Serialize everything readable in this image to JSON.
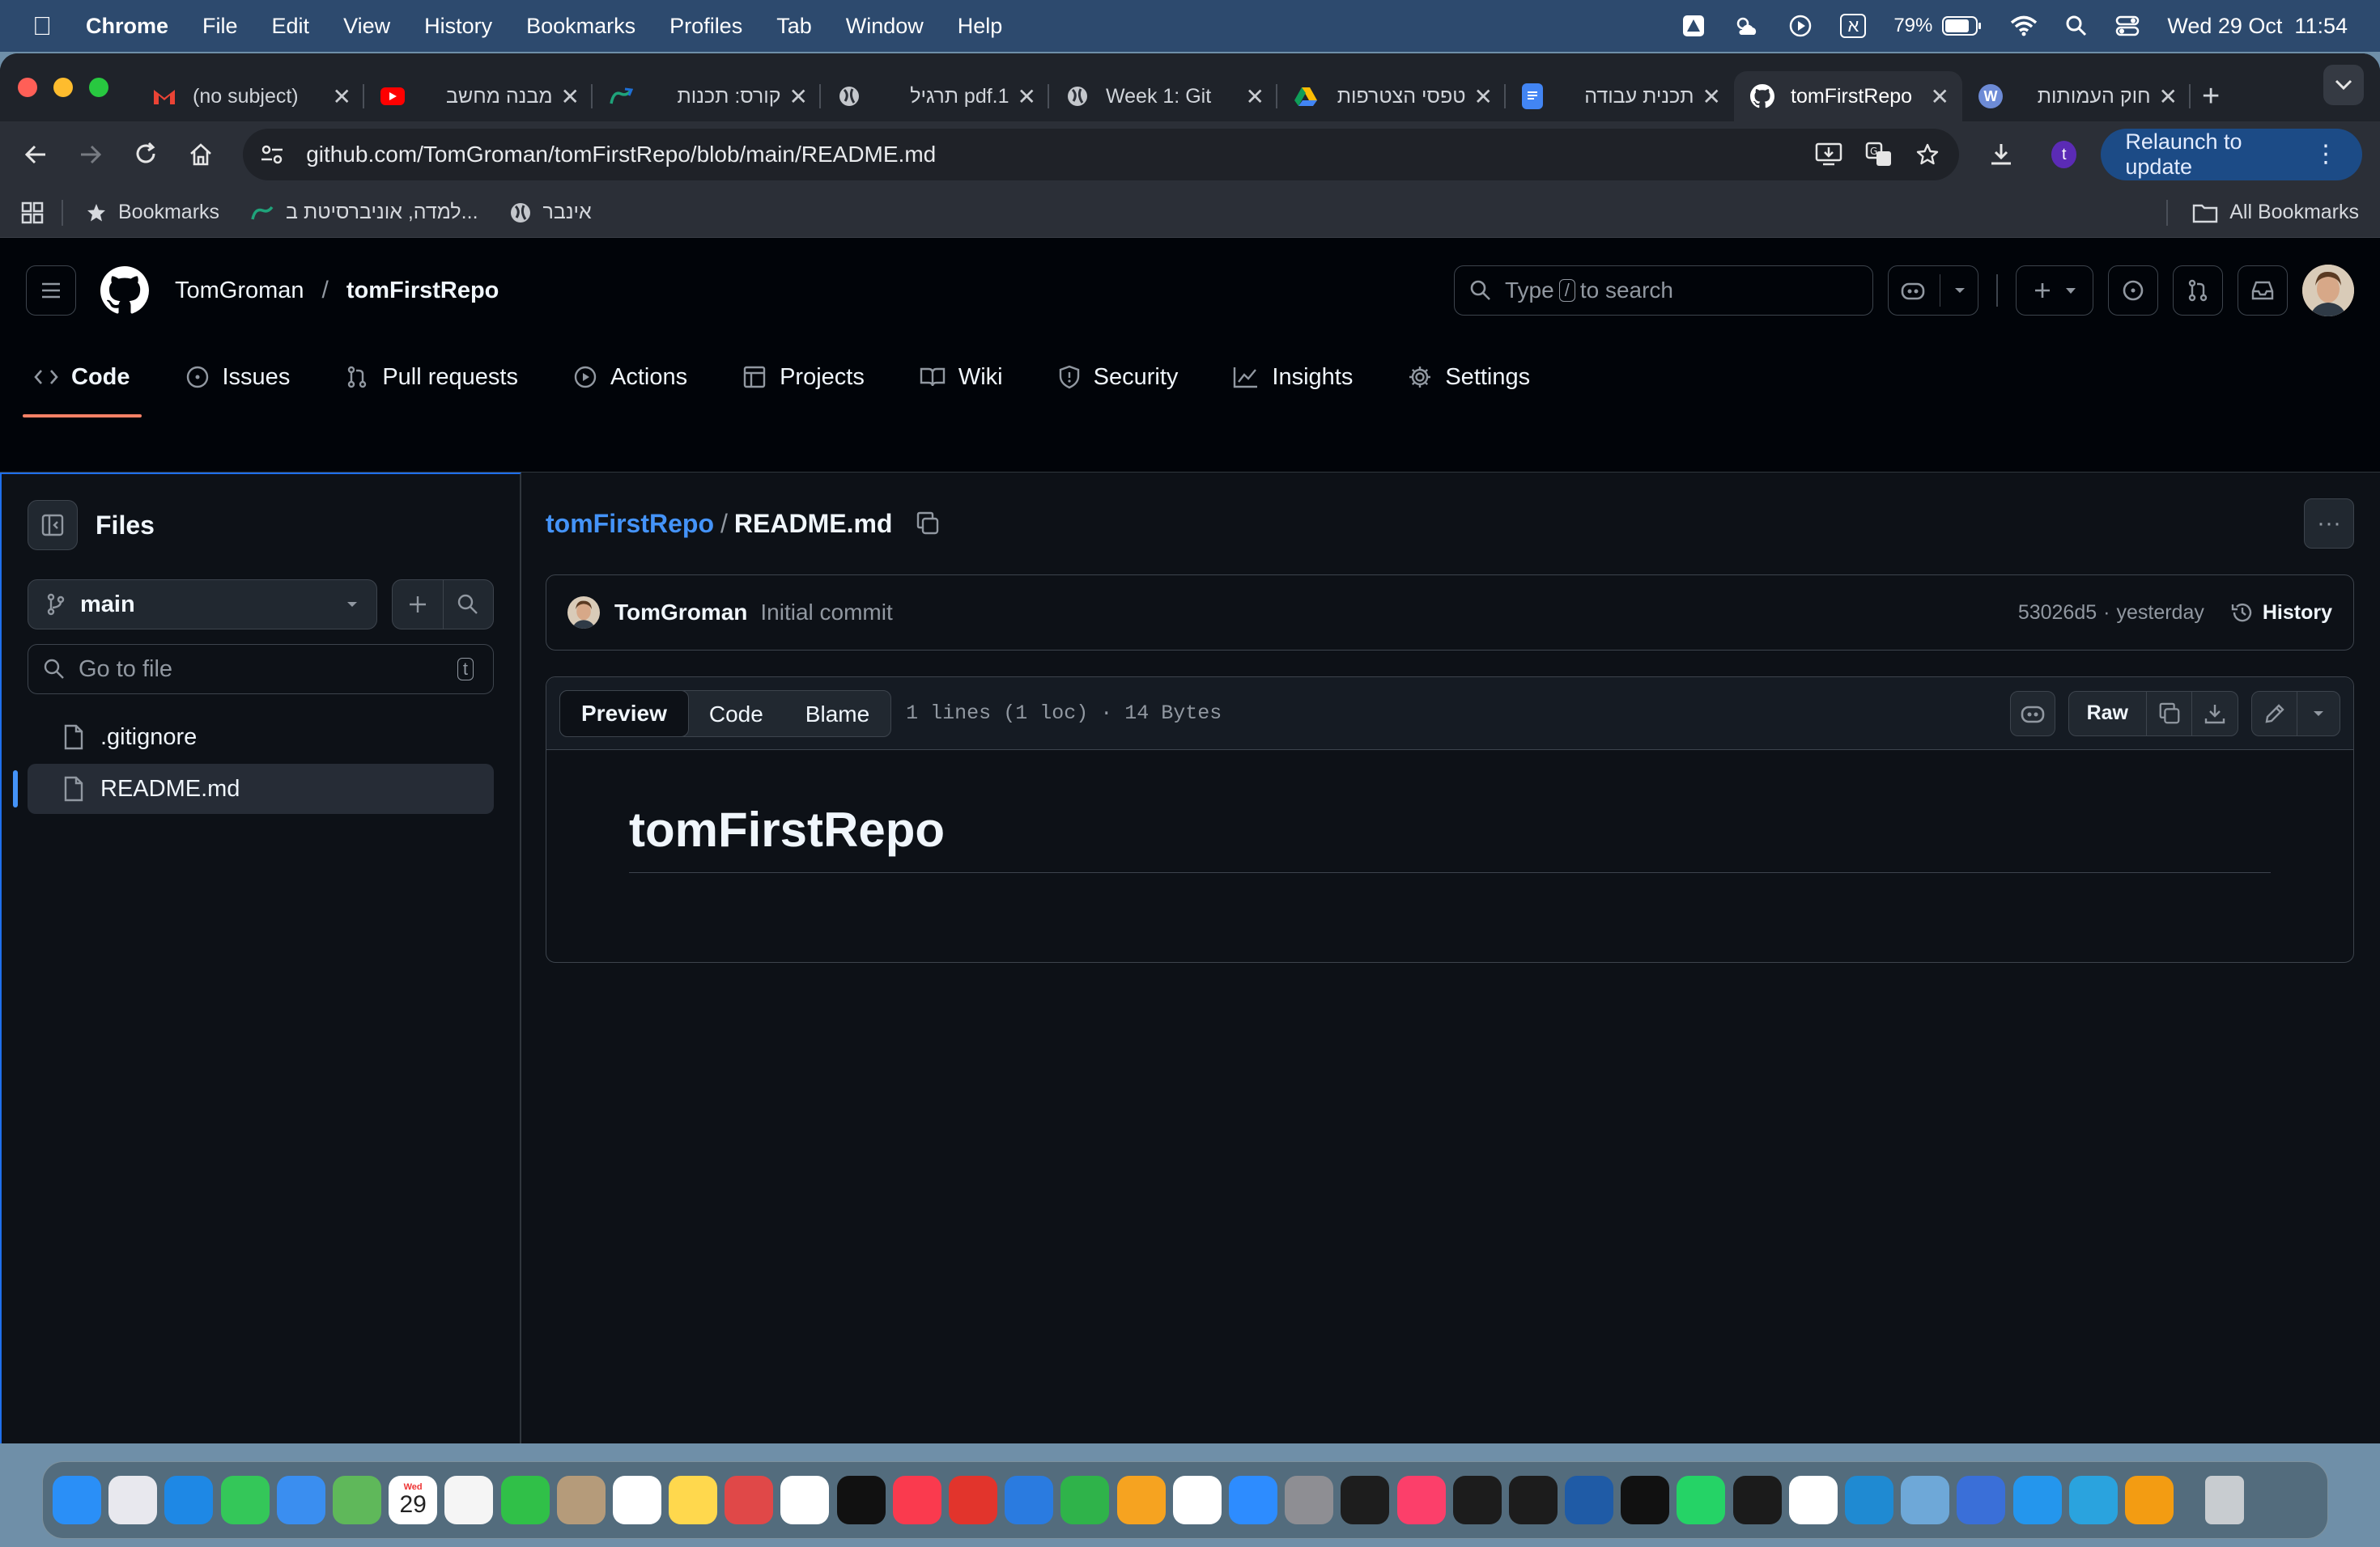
{
  "menubar": {
    "app": "Chrome",
    "items": [
      "File",
      "Edit",
      "View",
      "History",
      "Bookmarks",
      "Profiles",
      "Tab",
      "Window",
      "Help"
    ],
    "battery": "79%",
    "input_lang": "א",
    "datetime": "Wed 29 Oct  11:54"
  },
  "tabs": [
    {
      "title": "(no subject)",
      "icon": "gmail-icon",
      "color": "#ea4335"
    },
    {
      "title": "מבנה מחשב",
      "icon": "youtube-icon",
      "color": "#ff0000"
    },
    {
      "title": "קורס: תכנות",
      "icon": "moodle-icon",
      "color": "#1fa37a"
    },
    {
      "title": "pdf.1 תרגיל",
      "icon": "globe-icon",
      "color": "#9aa0a6"
    },
    {
      "title": "Week 1: Git",
      "icon": "globe-icon",
      "color": "#9aa0a6"
    },
    {
      "title": "טפסי הצטרפות",
      "icon": "drive-icon",
      "color": "#fbbc04"
    },
    {
      "title": "תכנית עבודה",
      "icon": "docs-icon",
      "color": "#4285f4"
    },
    {
      "title": "tomFirstRepo",
      "icon": "github-icon",
      "color": "#ffffff"
    },
    {
      "title": "חוק העמותות",
      "icon": "wiki-icon",
      "color": "#6d8bd6"
    }
  ],
  "omnibox": {
    "url": "github.com/TomGroman/tomFirstRepo/blob/main/README.md"
  },
  "profile_initial": "t",
  "relaunch_label": "Relaunch to update",
  "bookmarks": {
    "items": [
      "Bookmarks",
      "...למדה, אוניברסיטת ב",
      "אינבר"
    ],
    "all": "All Bookmarks"
  },
  "github": {
    "owner": "TomGroman",
    "repo": "tomFirstRepo",
    "search_prefix": "Type",
    "search_key": "/",
    "search_suffix": "to search",
    "nav": [
      "Code",
      "Issues",
      "Pull requests",
      "Actions",
      "Projects",
      "Wiki",
      "Security",
      "Insights",
      "Settings"
    ],
    "sidebar": {
      "title": "Files",
      "branch": "main",
      "goto_placeholder": "Go to file",
      "goto_key": "t",
      "files": [
        ".gitignore",
        "README.md"
      ]
    },
    "breadcrumb": {
      "repo": "tomFirstRepo",
      "sep": "/",
      "file": "README.md"
    },
    "commit": {
      "author": "TomGroman",
      "message": "Initial commit",
      "hash": "53026d5",
      "sep": "·",
      "when": "yesterday",
      "history_label": "History"
    },
    "file_view": {
      "tabs": [
        "Preview",
        "Code",
        "Blame"
      ],
      "meta": "1 lines (1 loc) · 14 Bytes",
      "raw_label": "Raw",
      "heading": "tomFirstRepo"
    }
  },
  "dock": {
    "date_month": "Wed",
    "date_day": "29",
    "apps": [
      {
        "name": "finder",
        "color": "#2a8ff7"
      },
      {
        "name": "launchpad",
        "color": "#e8e8ee"
      },
      {
        "name": "safari",
        "color": "#1e88e5"
      },
      {
        "name": "messages",
        "color": "#34c759"
      },
      {
        "name": "mail",
        "color": "#3a8ef0"
      },
      {
        "name": "maps",
        "color": "#5fb85a"
      },
      {
        "name": "calendar",
        "color": "#ffffff"
      },
      {
        "name": "photos",
        "color": "#f5f5f5"
      },
      {
        "name": "facetime",
        "color": "#30c048"
      },
      {
        "name": "contacts",
        "color": "#b59b7a"
      },
      {
        "name": "reminders",
        "color": "#ffffff"
      },
      {
        "name": "notes",
        "color": "#ffd84d"
      },
      {
        "name": "pdf-viewer",
        "color": "#e04848"
      },
      {
        "name": "freeform",
        "color": "#ffffff"
      },
      {
        "name": "apple-tv",
        "color": "#111111"
      },
      {
        "name": "music",
        "color": "#fa3a4e"
      },
      {
        "name": "podcast-app",
        "color": "#e2342c"
      },
      {
        "name": "keynote",
        "color": "#2a7be0"
      },
      {
        "name": "numbers",
        "color": "#2fb34a"
      },
      {
        "name": "pages",
        "color": "#f6a320"
      },
      {
        "name": "chrome",
        "color": "#ffffff"
      },
      {
        "name": "zoom",
        "color": "#2d8cff"
      },
      {
        "name": "system-settings",
        "color": "#8e8e93"
      },
      {
        "name": "terminal",
        "color": "#1d1d1d"
      },
      {
        "name": "intellij",
        "color": "#fc3f6a"
      },
      {
        "name": "clion",
        "color": "#1c1c1c"
      },
      {
        "name": "pycharm",
        "color": "#1c1c1c"
      },
      {
        "name": "wireshark",
        "color": "#1f5ba6"
      },
      {
        "name": "iterm",
        "color": "#111111"
      },
      {
        "name": "whatsapp",
        "color": "#25d366"
      },
      {
        "name": "capcut",
        "color": "#1b1b1b"
      },
      {
        "name": "google-drive",
        "color": "#ffffff"
      },
      {
        "name": "vscode",
        "color": "#1f8ad2"
      },
      {
        "name": "database-app",
        "color": "#6ea8d8"
      },
      {
        "name": "simulator",
        "color": "#3a6fd8"
      },
      {
        "name": "docker",
        "color": "#2496ed"
      },
      {
        "name": "telegram",
        "color": "#2aa3de"
      },
      {
        "name": "infuse",
        "color": "#f39c12"
      },
      {
        "name": "trash",
        "color": "#c8ccd0"
      }
    ]
  }
}
